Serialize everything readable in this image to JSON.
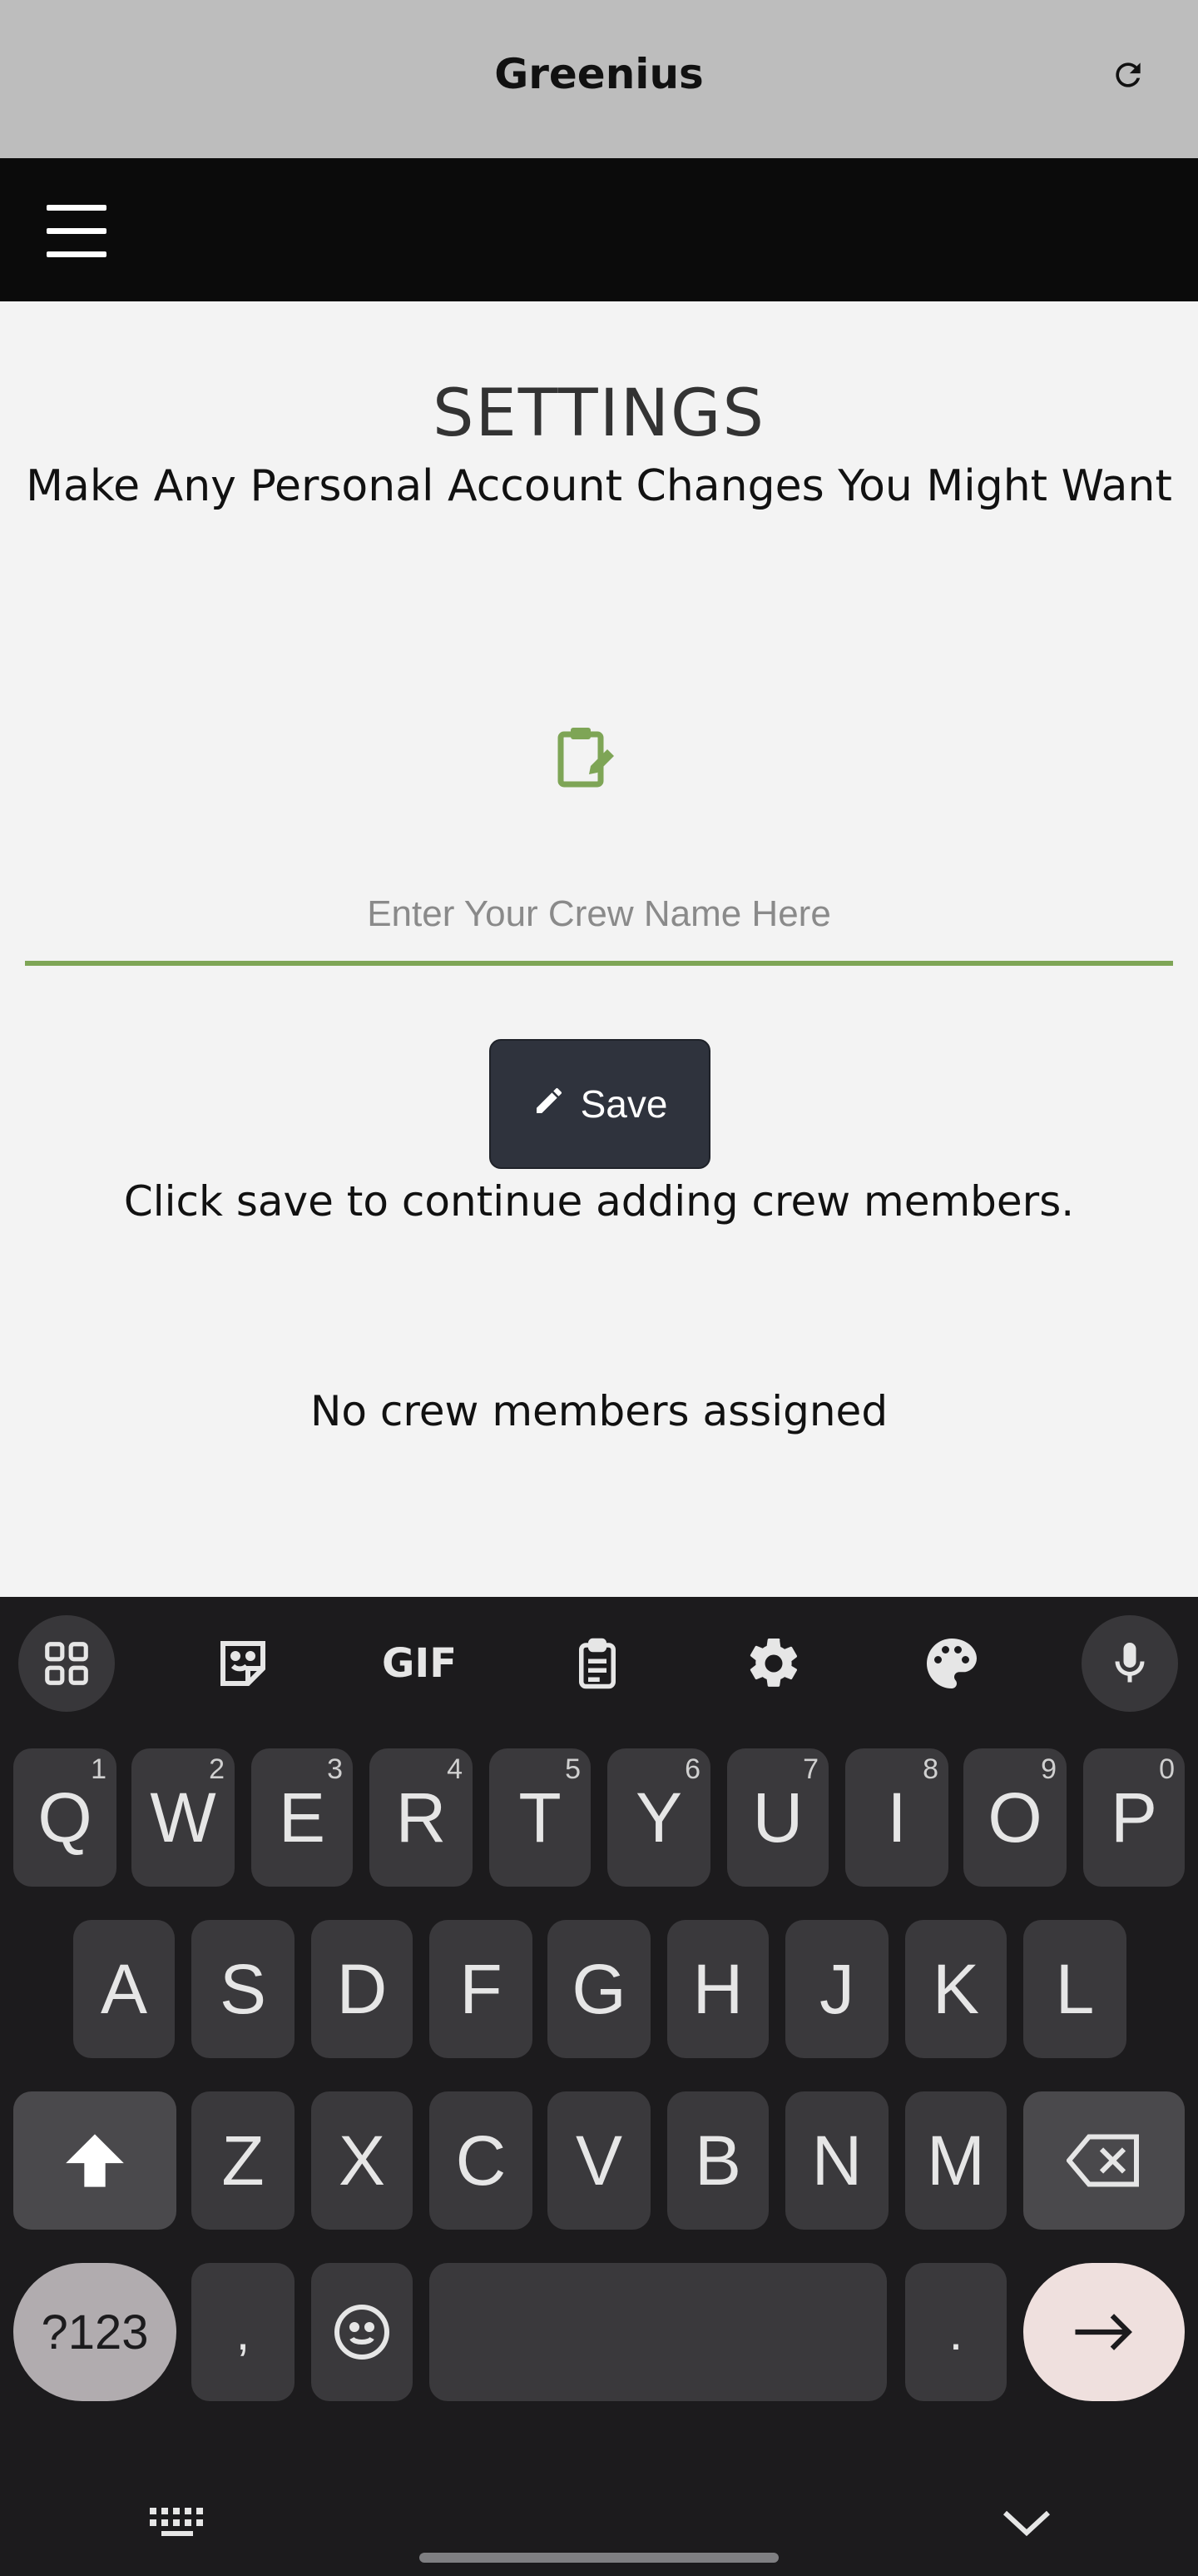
{
  "app": {
    "title": "Greenius",
    "refresh_icon": "refresh-icon"
  },
  "nav": {
    "menu_icon": "hamburger-menu-icon"
  },
  "settings": {
    "heading": "SETTINGS",
    "subheading": "Make Any Personal Account Changes You Might Want",
    "crew_input_placeholder": "Enter Your Crew Name Here",
    "crew_input_value": "",
    "save_label": "Save",
    "hint": "Click save to continue adding crew members.",
    "no_crew": "No crew members assigned"
  },
  "colors": {
    "accent": "#7ea556",
    "button": "#2f333d",
    "titlebar": "#bdbdbd",
    "navbar": "#0b0b0b"
  },
  "keyboard": {
    "toolbar": [
      "apps-grid-icon",
      "sticker-icon",
      "gif-icon",
      "clipboard-icon",
      "settings-gear-icon",
      "palette-icon",
      "microphone-icon"
    ],
    "gif_label": "GIF",
    "row1": [
      {
        "k": "Q",
        "n": "1"
      },
      {
        "k": "W",
        "n": "2"
      },
      {
        "k": "E",
        "n": "3"
      },
      {
        "k": "R",
        "n": "4"
      },
      {
        "k": "T",
        "n": "5"
      },
      {
        "k": "Y",
        "n": "6"
      },
      {
        "k": "U",
        "n": "7"
      },
      {
        "k": "I",
        "n": "8"
      },
      {
        "k": "O",
        "n": "9"
      },
      {
        "k": "P",
        "n": "0"
      }
    ],
    "row2": [
      "A",
      "S",
      "D",
      "F",
      "G",
      "H",
      "J",
      "K",
      "L"
    ],
    "row3": [
      "Z",
      "X",
      "C",
      "V",
      "B",
      "N",
      "M"
    ],
    "sym_label": "?123",
    "comma": ",",
    "period": "."
  }
}
